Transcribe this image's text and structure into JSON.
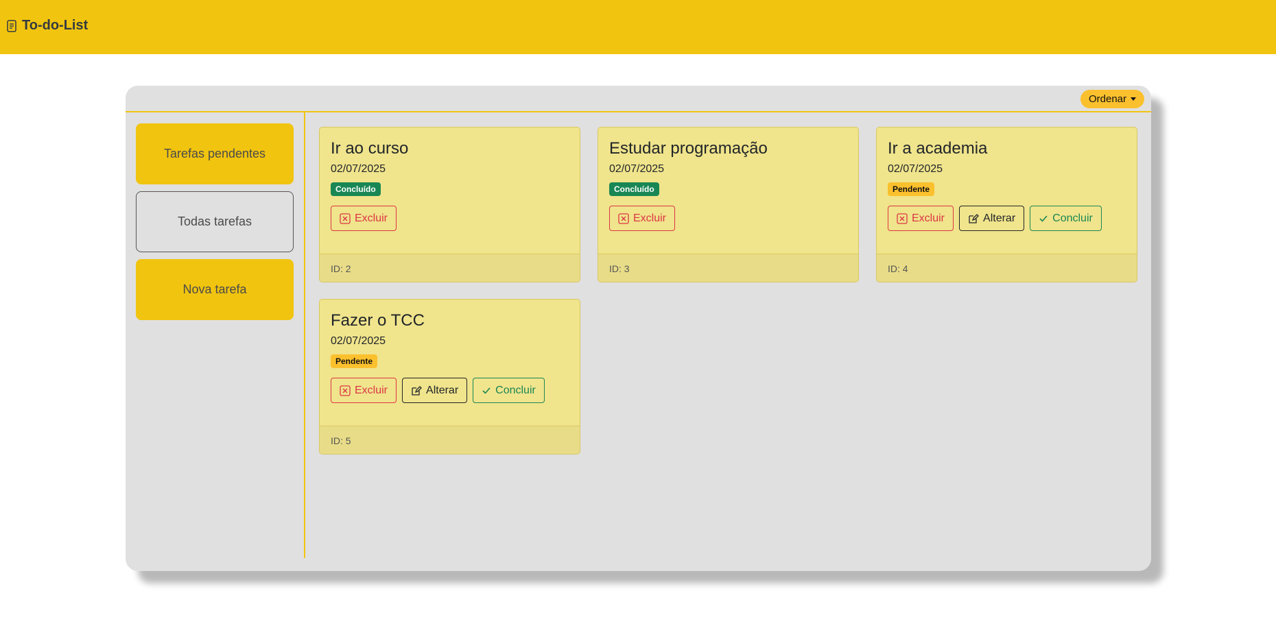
{
  "navbar": {
    "title": "To-do-List",
    "icon": "document-icon"
  },
  "toolbar": {
    "sort_label": "Ordenar"
  },
  "sidebar": {
    "items": [
      {
        "label": "Tarefas pendentes"
      },
      {
        "label": "Todas tarefas"
      },
      {
        "label": "Nova tarefa"
      }
    ]
  },
  "tasks": [
    {
      "title": "Ir ao curso",
      "date": "02/07/2025",
      "status": "Concluído",
      "id": "ID: 2"
    },
    {
      "title": "Estudar programação",
      "date": "02/07/2025",
      "status": "Concluído",
      "id": "ID: 3"
    },
    {
      "title": "Ir a academia",
      "date": "02/07/2025",
      "status": "Pendente",
      "id": "ID: 4"
    },
    {
      "title": "Fazer o TCC",
      "date": "02/07/2025",
      "status": "Pendente",
      "id": "ID: 5"
    }
  ],
  "actions": {
    "delete": "Excluir",
    "edit": "Alterar",
    "complete": "Concluir"
  },
  "colors": {
    "brand": "#f1c40f",
    "done": "#198754",
    "pending": "#fbc02d",
    "danger": "#dc3545",
    "card": "#f0e48c"
  }
}
